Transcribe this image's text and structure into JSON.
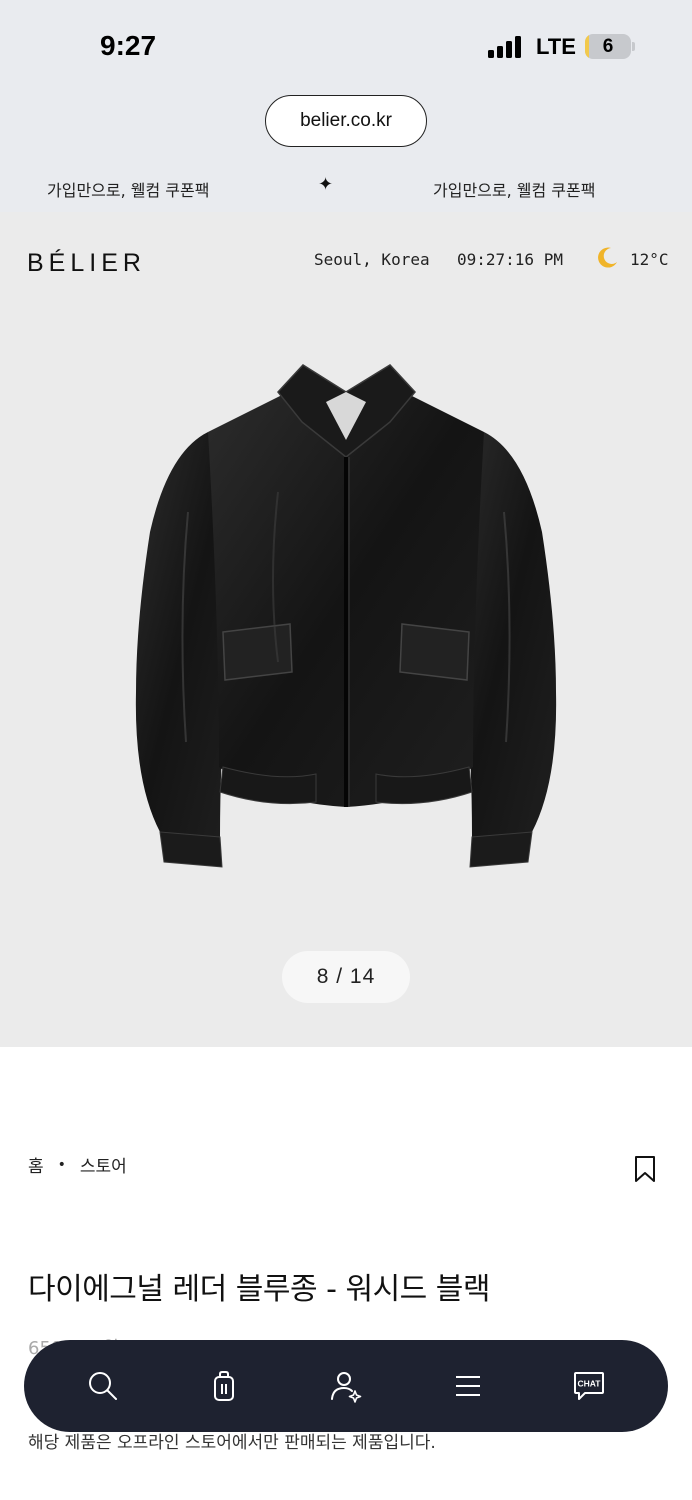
{
  "status_bar": {
    "time": "9:27",
    "network": "LTE",
    "battery": "6",
    "battery_fill_fraction": 0.06,
    "signal_bars": 4
  },
  "browser": {
    "url": "belier.co.kr"
  },
  "promo_marquee": {
    "items": [
      "가입만으로, 웰컴 쿠폰팩",
      "가입만으로, 웰컴 쿠폰팩"
    ],
    "separator": "✦"
  },
  "header": {
    "logo": "BÉLIER",
    "city": "Seoul, Korea",
    "clock": "09:27:16 PM",
    "weather_icon": "moon-icon",
    "temperature": "12°C"
  },
  "gallery": {
    "counter": "8 / 14",
    "image": "black-leather-jacket"
  },
  "product": {
    "breadcrumb": [
      "홈",
      "스토어"
    ],
    "title": "다이에그널 레더 블루종 - 워시드 블랙",
    "price": "650,000원",
    "notice": "해당 제품은 오프라인 스토어에서만 판매되는 제품입니다."
  },
  "bottom_nav": {
    "items": [
      "search-icon",
      "shopping-bag-icon",
      "account-icon",
      "menu-icon",
      "chat-icon"
    ],
    "chat_label": "CHAT"
  },
  "colors": {
    "nav_bg": "#1e2230",
    "hero_bg": "#ebebeb",
    "chrome_bg": "#e9ebef",
    "battery_accent": "#f2c94c"
  }
}
